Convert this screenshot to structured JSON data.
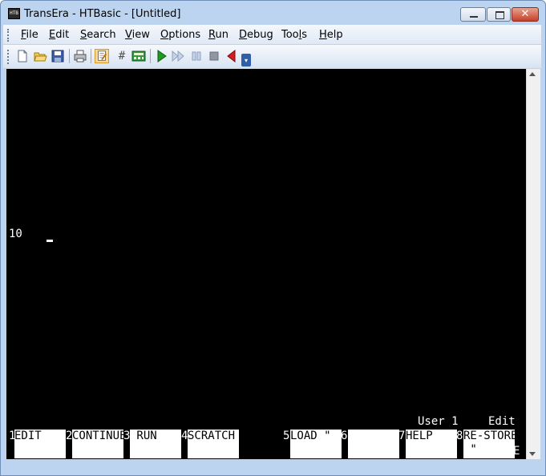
{
  "window": {
    "title": "TransEra - HTBasic - [Untitled]",
    "app_icon_text": "HTB"
  },
  "menu": [
    {
      "pre": "",
      "ul": "F",
      "post": "ile"
    },
    {
      "pre": "",
      "ul": "E",
      "post": "dit"
    },
    {
      "pre": "",
      "ul": "S",
      "post": "earch"
    },
    {
      "pre": "",
      "ul": "V",
      "post": "iew"
    },
    {
      "pre": "",
      "ul": "O",
      "post": "ptions"
    },
    {
      "pre": "",
      "ul": "R",
      "post": "un"
    },
    {
      "pre": "",
      "ul": "D",
      "post": "ebug"
    },
    {
      "pre": "Too",
      "ul": "l",
      "post": "s"
    },
    {
      "pre": "",
      "ul": "H",
      "post": "elp"
    }
  ],
  "toolbar": {
    "icons": [
      "new-file-icon",
      "open-folder-icon",
      "save-icon",
      "print-icon",
      "edit-program-icon",
      "line-number-icon",
      "calculator-icon",
      "run-icon",
      "continue-icon",
      "pause-icon",
      "stop-icon",
      "step-back-icon"
    ],
    "line_number_glyph": "#"
  },
  "colors": {
    "terminal_bg": "#000000",
    "terminal_fg": "#ffffff",
    "frame": "#bcd4ef",
    "run_green": "#1f9a1f",
    "back_red": "#d41d1d"
  },
  "terminal": {
    "line_number": "10",
    "status_user": "User 1",
    "status_mode": "Edit"
  },
  "softkeys": [
    {
      "num": "1",
      "label": "EDIT"
    },
    {
      "num": "2",
      "label": "CONTINUE"
    },
    {
      "num": "3",
      "label": " RUN"
    },
    {
      "num": "4",
      "label": "SCRATCH"
    },
    {
      "num": "5",
      "label": "LOAD \""
    },
    {
      "num": "6",
      "label": ""
    },
    {
      "num": "7",
      "label": "HELP"
    },
    {
      "num": "8",
      "label": "RE-STORE\n \""
    }
  ],
  "softkey_tail": "E"
}
